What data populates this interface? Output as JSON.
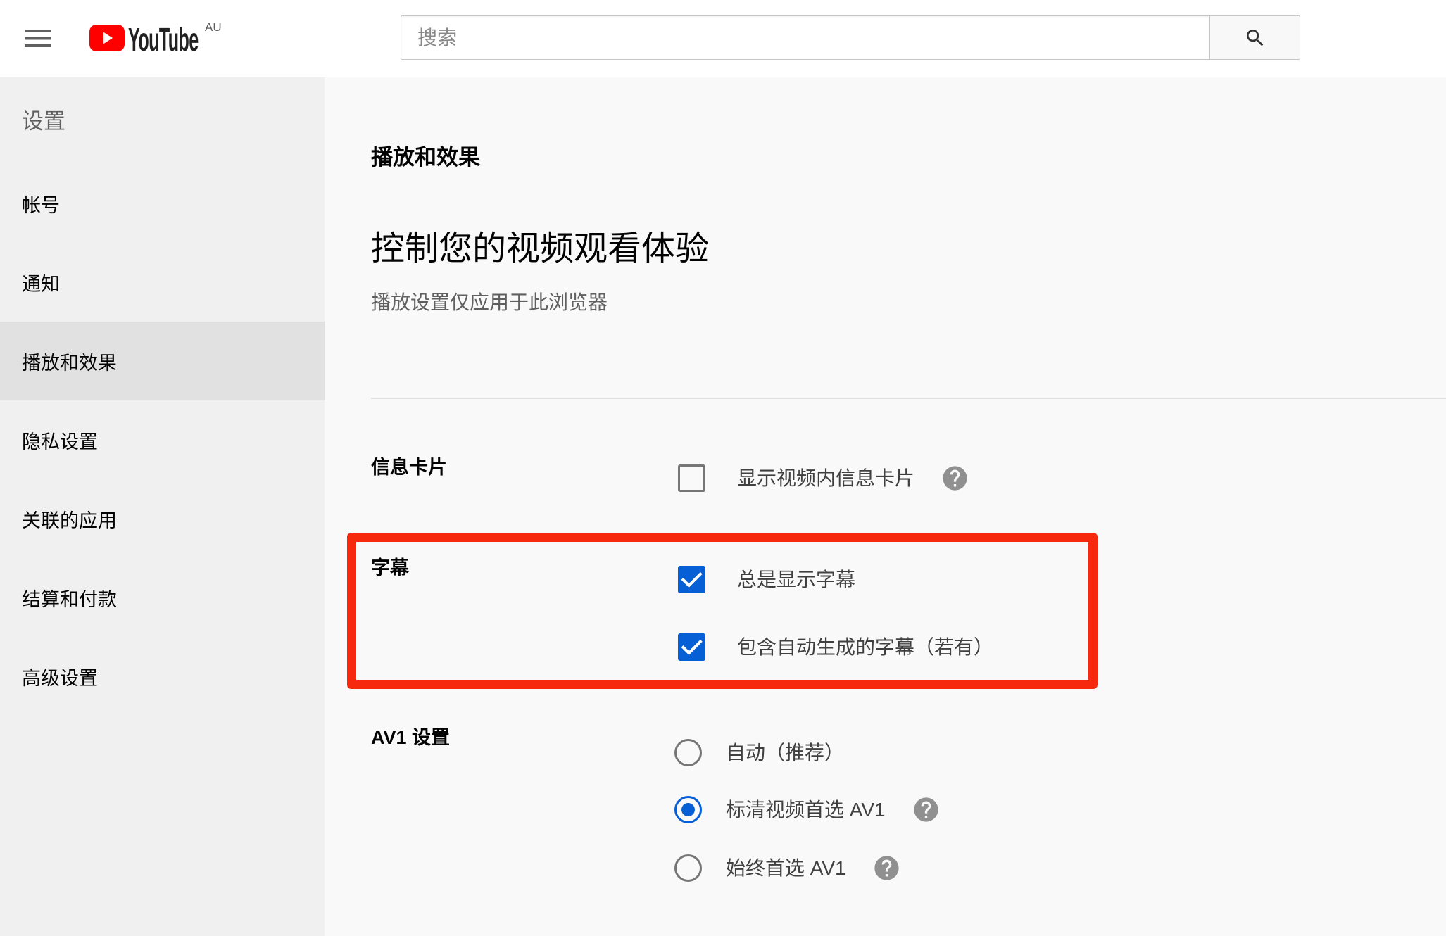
{
  "header": {
    "logo_text": "YouTube",
    "country_code": "AU",
    "search": {
      "placeholder": "搜索",
      "value": ""
    },
    "icons": {
      "menu": "hamburger-menu-icon",
      "logo": "youtube-play-logo-icon",
      "search": "search-icon"
    }
  },
  "sidebar": {
    "title": "设置",
    "items": [
      {
        "label": "帐号",
        "active": false
      },
      {
        "label": "通知",
        "active": false
      },
      {
        "label": "播放和效果",
        "active": true
      },
      {
        "label": "隐私设置",
        "active": false
      },
      {
        "label": "关联的应用",
        "active": false
      },
      {
        "label": "结算和付款",
        "active": false
      },
      {
        "label": "高级设置",
        "active": false
      }
    ]
  },
  "main": {
    "section_title": "播放和效果",
    "heading": "控制您的视频观看体验",
    "subheading": "播放设置仅应用于此浏览器",
    "settings": {
      "info_cards": {
        "label": "信息卡片",
        "options": [
          {
            "label": "显示视频内信息卡片",
            "checked": false,
            "help_icon": true
          }
        ]
      },
      "captions": {
        "label": "字幕",
        "highlighted": true,
        "options": [
          {
            "label": "总是显示字幕",
            "checked": true
          },
          {
            "label": "包含自动生成的字幕（若有）",
            "checked": true
          }
        ]
      },
      "av1": {
        "label": "AV1 设置",
        "options": [
          {
            "label": "自动（推荐）",
            "selected": false,
            "help_icon": false
          },
          {
            "label": "标清视频首选 AV1",
            "selected": true,
            "help_icon": true
          },
          {
            "label": "始终首选 AV1",
            "selected": false,
            "help_icon": true
          }
        ]
      }
    }
  },
  "colors": {
    "brand_red": "#ff0000",
    "accent_blue": "#065fd4",
    "highlight_red": "#f6290f",
    "sidebar_active": "#e1e1e1"
  }
}
